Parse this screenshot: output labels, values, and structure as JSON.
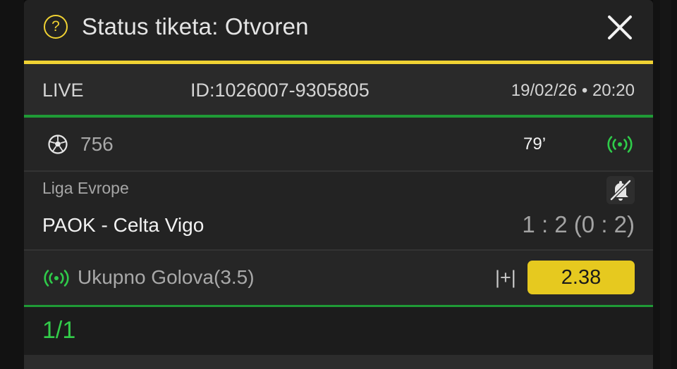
{
  "header": {
    "title": "Status tiketa: Otvoren",
    "help_icon_glyph": "?",
    "accent_color": "#f0d233"
  },
  "ticket": {
    "status_label": "LIVE",
    "id": "ID:1026007-9305805",
    "datetime": "19/02/26 • 20:20"
  },
  "match": {
    "sport_icon": "soccer-ball-icon",
    "number": "756",
    "minute": "79’",
    "live_indicator_icon": "live-broadcast-icon",
    "league": "Liga Evrope",
    "teams": "PAOK - Celta Vigo",
    "score": "1 : 2 (0 : 2)",
    "notification_icon": "bell-off-icon"
  },
  "bet": {
    "market": "Ukupno Golova(3.5)",
    "pick": "|+|",
    "odds": "2.38",
    "odds_button_color": "#e6c91f"
  },
  "summary": {
    "count": "1/1",
    "count_color": "#33cc4a"
  }
}
